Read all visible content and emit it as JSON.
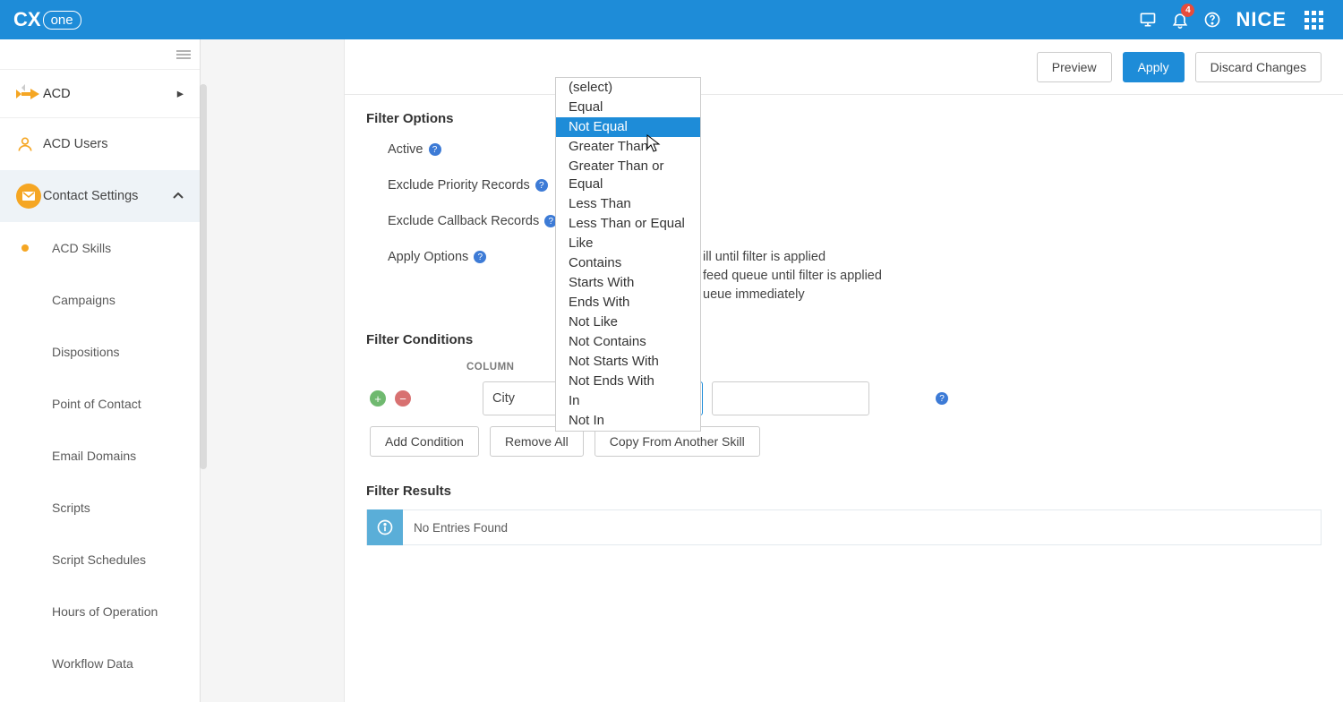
{
  "topbar": {
    "notification_count": "4"
  },
  "sidebar": {
    "acd_label": "ACD",
    "acd_users_label": "ACD Users",
    "contact_settings_label": "Contact Settings",
    "sub_items": [
      {
        "label": "ACD Skills",
        "active": true
      },
      {
        "label": "Campaigns"
      },
      {
        "label": "Dispositions"
      },
      {
        "label": "Point of Contact"
      },
      {
        "label": "Email Domains"
      },
      {
        "label": "Scripts"
      },
      {
        "label": "Script Schedules"
      },
      {
        "label": "Hours of Operation"
      },
      {
        "label": "Workflow Data"
      }
    ]
  },
  "actions": {
    "preview": "Preview",
    "apply": "Apply",
    "discard": "Discard Changes"
  },
  "filter_options": {
    "title": "Filter Options",
    "active": "Active",
    "exclude_priority": "Exclude Priority Records",
    "exclude_callback": "Exclude Callback Records",
    "apply_options": "Apply Options",
    "apply_1_tail": "ill until filter is applied",
    "apply_2_tail": "feed queue until filter is applied",
    "apply_3_tail": "ueue immediately"
  },
  "filter_conditions": {
    "title": "Filter Conditions",
    "column_header": "COLUMN",
    "column_value": "City",
    "operator_value": "(select)",
    "add_condition": "Add Condition",
    "remove_all": "Remove All",
    "copy_from": "Copy From Another Skill"
  },
  "dropdown": {
    "items": [
      "(select)",
      "Equal",
      "Not Equal",
      "Greater Than",
      "Greater Than or Equal",
      "Less Than",
      "Less Than or Equal",
      "Like",
      "Contains",
      "Starts With",
      "Ends With",
      "Not Like",
      "Not Contains",
      "Not Starts With",
      "Not Ends With",
      "In",
      "Not In"
    ],
    "highlighted_index": 2
  },
  "filter_results": {
    "title": "Filter Results",
    "message": "No Entries Found"
  }
}
